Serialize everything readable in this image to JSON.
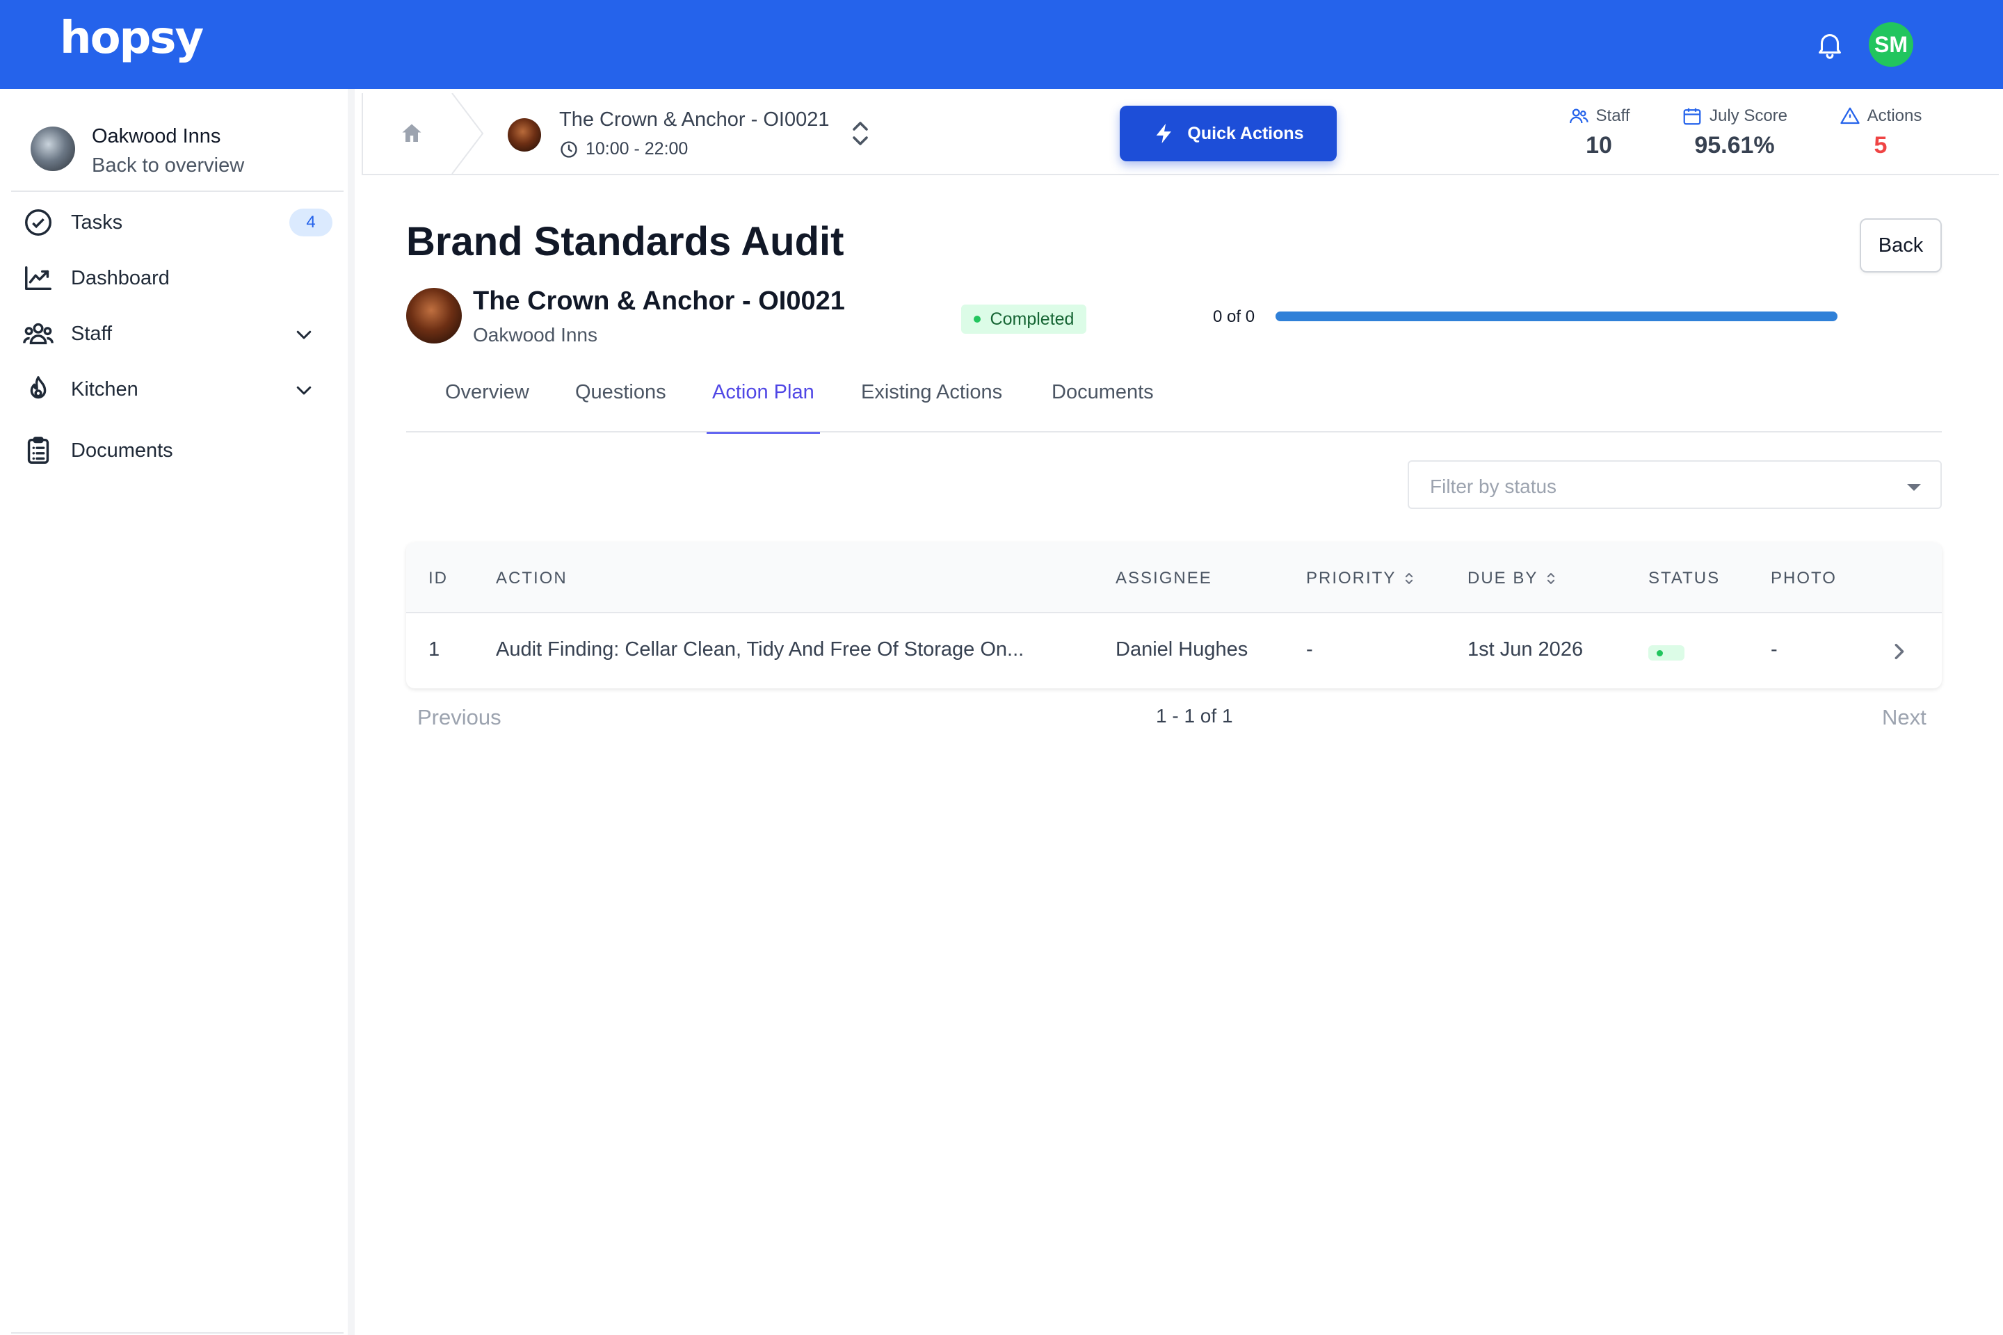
{
  "app": {
    "logo": "hopsy",
    "user_initials": "SM"
  },
  "sidebar": {
    "org_name": "Oakwood Inns",
    "back_label": "Back to overview",
    "items": [
      {
        "label": "Tasks",
        "icon": "check-circle-icon",
        "badge": "4"
      },
      {
        "label": "Dashboard",
        "icon": "trend-chart-icon"
      },
      {
        "label": "Staff",
        "icon": "users-icon"
      },
      {
        "label": "Kitchen",
        "icon": "flame-icon"
      },
      {
        "label": "Documents",
        "icon": "clipboard-icon"
      }
    ]
  },
  "subheader": {
    "site_name": "The Crown & Anchor - OI0021",
    "site_hours": "10:00 - 22:00",
    "quick_actions_label": "Quick Actions",
    "stats": [
      {
        "label": "Staff",
        "value": "10",
        "icon": "users-icon"
      },
      {
        "label": "July Score",
        "value": "95.61%",
        "icon": "calendar-icon"
      },
      {
        "label": "Actions",
        "value": "5",
        "icon": "warning-icon",
        "color": "#ef4444"
      }
    ]
  },
  "audit": {
    "title": "Brand Standards Audit",
    "back_label": "Back",
    "site_name": "The Crown & Anchor - OI0021",
    "org_name": "Oakwood Inns",
    "status": "Completed",
    "progress_label": "0 of 0",
    "progress_fraction": 1.0
  },
  "tabs": [
    {
      "label": "Overview",
      "active": false
    },
    {
      "label": "Questions",
      "active": false
    },
    {
      "label": "Action Plan",
      "active": true
    },
    {
      "label": "Existing Actions",
      "active": false
    },
    {
      "label": "Documents",
      "active": false
    }
  ],
  "filter": {
    "placeholder": "Filter by status"
  },
  "table": {
    "columns": [
      "ID",
      "ACTION",
      "ASSIGNEE",
      "PRIORITY",
      "DUE BY",
      "STATUS",
      "PHOTO"
    ],
    "rows": [
      {
        "id": "1",
        "action": "Audit Finding: Cellar Clean, Tidy And Free Of Storage On...",
        "assignee": "Daniel Hughes",
        "priority": "-",
        "due_by": "1st Jun 2026",
        "photo": "-"
      }
    ]
  },
  "pagination": {
    "previous": "Previous",
    "info": "1 - 1 of 1",
    "next": "Next"
  },
  "colors": {
    "brand": "#2563eb",
    "accent": "#1d4ed8",
    "success": "#22c55e",
    "danger": "#ef4444"
  }
}
